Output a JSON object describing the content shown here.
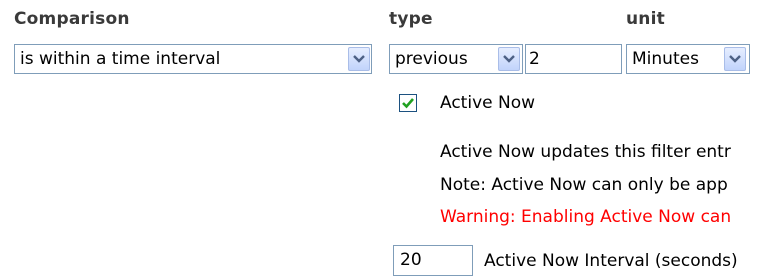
{
  "headers": {
    "comparison": "Comparison",
    "type": "type",
    "unit": "unit"
  },
  "comparison_select": {
    "value": "is within a time interval"
  },
  "type_select": {
    "value": "previous"
  },
  "amount_input": {
    "value": "2"
  },
  "unit_select": {
    "value": "Minutes"
  },
  "active_now": {
    "checked": true,
    "label": "Active Now",
    "description": "Active Now updates this filter entr",
    "note": "Note: Active Now can only be app",
    "warning": "Warning: Enabling Active Now can"
  },
  "interval": {
    "value": "20",
    "label": "Active Now Interval (seconds)"
  },
  "colors": {
    "border": "#7f9db9",
    "checkmark": "#21a121",
    "warning": "#ff0000"
  }
}
